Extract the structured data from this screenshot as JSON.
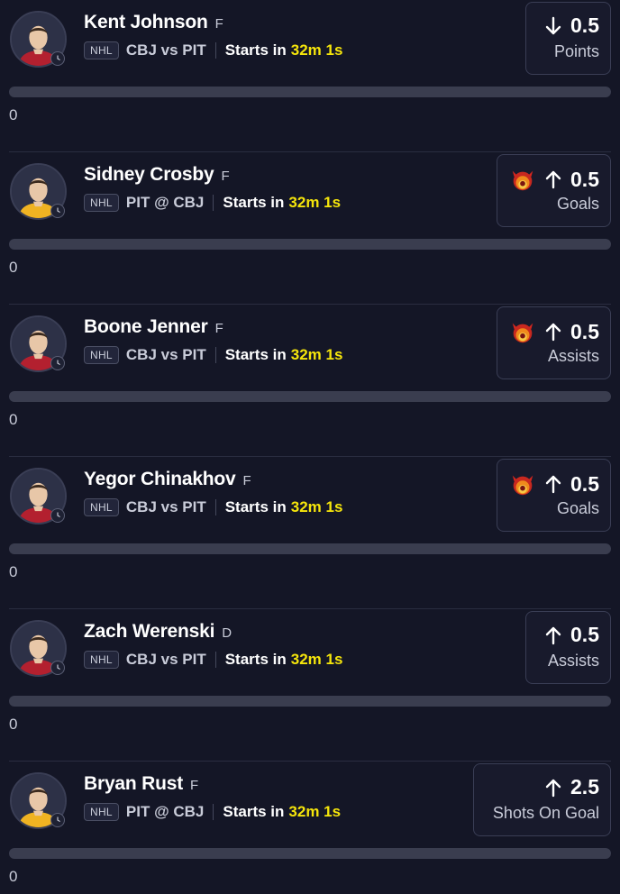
{
  "colors": {
    "background": "#141626",
    "countdown": "#f5e50b",
    "card_border": "#3a3e55",
    "track": "#3a3d4f"
  },
  "props": [
    {
      "name": "Kent Johnson",
      "position": "F",
      "league": "NHL",
      "matchup": "CBJ vs PIT",
      "starts_label": "Starts in",
      "countdown": "32m 1s",
      "direction": "down",
      "hot": false,
      "line": "0.5",
      "stat": "Points",
      "progress_text": "0",
      "progress_fraction": 0,
      "jersey_color": "#b3202f"
    },
    {
      "name": "Sidney Crosby",
      "position": "F",
      "league": "NHL",
      "matchup": "PIT @ CBJ",
      "starts_label": "Starts in",
      "countdown": "32m 1s",
      "direction": "up",
      "hot": true,
      "line": "0.5",
      "stat": "Goals",
      "progress_text": "0",
      "progress_fraction": 0,
      "jersey_color": "#f0b322"
    },
    {
      "name": "Boone Jenner",
      "position": "F",
      "league": "NHL",
      "matchup": "CBJ vs PIT",
      "starts_label": "Starts in",
      "countdown": "32m 1s",
      "direction": "up",
      "hot": true,
      "line": "0.5",
      "stat": "Assists",
      "progress_text": "0",
      "progress_fraction": 0,
      "jersey_color": "#b3202f"
    },
    {
      "name": "Yegor Chinakhov",
      "position": "F",
      "league": "NHL",
      "matchup": "CBJ vs PIT",
      "starts_label": "Starts in",
      "countdown": "32m 1s",
      "direction": "up",
      "hot": true,
      "line": "0.5",
      "stat": "Goals",
      "progress_text": "0",
      "progress_fraction": 0,
      "jersey_color": "#b3202f"
    },
    {
      "name": "Zach Werenski",
      "position": "D",
      "league": "NHL",
      "matchup": "CBJ vs PIT",
      "starts_label": "Starts in",
      "countdown": "32m 1s",
      "direction": "up",
      "hot": false,
      "line": "0.5",
      "stat": "Assists",
      "progress_text": "0",
      "progress_fraction": 0,
      "jersey_color": "#b3202f"
    },
    {
      "name": "Bryan Rust",
      "position": "F",
      "league": "NHL",
      "matchup": "PIT @ CBJ",
      "starts_label": "Starts in",
      "countdown": "32m 1s",
      "direction": "up",
      "hot": false,
      "line": "2.5",
      "stat": "Shots On Goal",
      "progress_text": "0",
      "progress_fraction": 0,
      "jersey_color": "#f0b322"
    }
  ]
}
